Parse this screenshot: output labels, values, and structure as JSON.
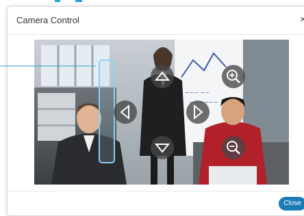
{
  "dialog": {
    "title": "Camera Control",
    "close_icon": "close-icon",
    "close_label": "Close"
  },
  "controls": {
    "up": "up-arrow-icon",
    "down": "down-arrow-icon",
    "left": "left-arrow-icon",
    "right": "right-arrow-icon",
    "zoom_in": "zoom-in-icon",
    "zoom_out": "zoom-out-icon"
  },
  "colors": {
    "accent": "#1c7ab7",
    "callout": "#2aa0d6",
    "control_bg": "#464646"
  }
}
